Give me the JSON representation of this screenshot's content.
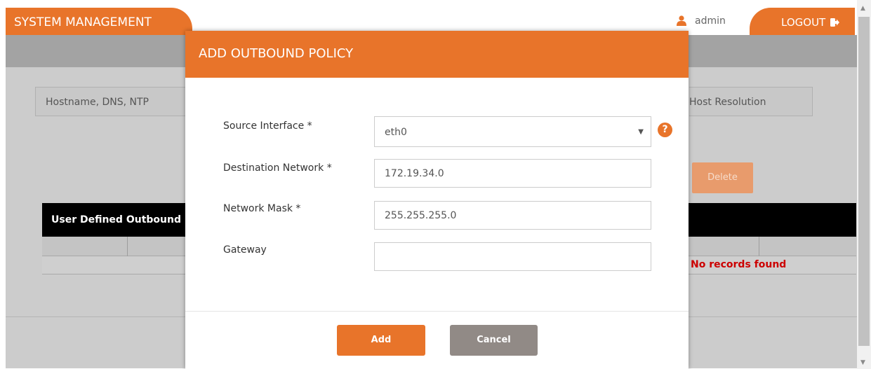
{
  "header": {
    "title": "SYSTEM MANAGEMENT",
    "user": "admin",
    "logout_label": "LOGOUT"
  },
  "tabs": [
    "Hostname, DNS, NTP",
    "Host Resolution"
  ],
  "background": {
    "delete_label": "Delete",
    "table_title": "User Defined Outbound",
    "empty_message": "No records found"
  },
  "modal": {
    "title": "ADD OUTBOUND POLICY",
    "fields": {
      "source_interface": {
        "label": "Source Interface *",
        "value": "eth0"
      },
      "destination_network": {
        "label": "Destination Network *",
        "value": "172.19.34.0"
      },
      "network_mask": {
        "label": "Network Mask *",
        "value": "255.255.255.0"
      },
      "gateway": {
        "label": "Gateway",
        "value": ""
      }
    },
    "help_symbol": "?",
    "add_label": "Add",
    "cancel_label": "Cancel"
  },
  "colors": {
    "accent": "#e8742a",
    "cancel": "#918a86",
    "error": "#cc0000"
  },
  "icons": {
    "user": "user-icon",
    "logout": "logout-icon",
    "help": "help-icon",
    "dropdown": "chevron-down-icon"
  }
}
